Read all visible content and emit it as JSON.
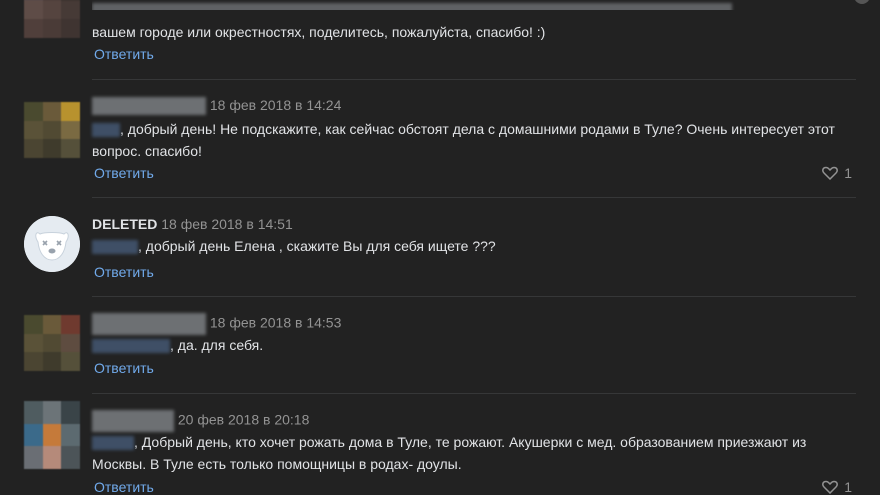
{
  "comments": [
    {
      "text_top": "",
      "text": "вашем городе или окрестностях, поделитесь, пожалуйста, спасибо! :)",
      "reply": "Ответить"
    },
    {
      "author": "",
      "date": "18 фев 2018 в 14:24",
      "text": ", добрый день! Не подскажите, как сейчас обстоят дела с домашними родами в Туле? Очень интересует этот вопрос. спасибо!",
      "reply": "Ответить",
      "likes": "1"
    },
    {
      "author": "DELETED",
      "date": "18 фев 2018 в 14:51",
      "text": ", добрый день Елена , скажите Вы для себя ищете ???",
      "reply": "Ответить"
    },
    {
      "author": "",
      "date": "18 фев 2018 в 14:53",
      "text": ", да. для себя.",
      "reply": "Ответить"
    },
    {
      "author": "",
      "date": "20 фев 2018 в 20:18",
      "text": ", Добрый день, кто хочет рожать дома в Туле, те рожают. Акушерки с мед. образованием приезжают из Москвы. В Туле есть только помощницы в родах- доулы.",
      "reply": "Ответить",
      "likes": "1"
    }
  ],
  "colors": {
    "background": "#222222",
    "link": "#71aaeb",
    "text": "#e1e3e6",
    "muted": "#939393"
  }
}
